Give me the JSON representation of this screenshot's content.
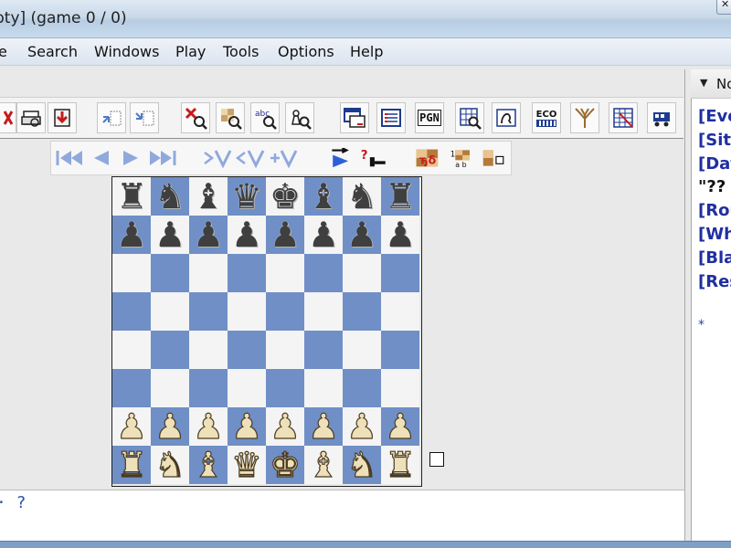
{
  "window": {
    "title": "pty] (game 0 / 0)"
  },
  "menu": {
    "items": [
      "e",
      "Search",
      "Windows",
      "Play",
      "Tools",
      "Options",
      "Help"
    ]
  },
  "toolbar": {
    "pgn_label": "PGN",
    "eco_label": "ECO"
  },
  "board": {
    "ranks": [
      [
        "r",
        "n",
        "b",
        "q",
        "k",
        "b",
        "n",
        "r"
      ],
      [
        "p",
        "p",
        "p",
        "p",
        "p",
        "p",
        "p",
        "p"
      ],
      [
        "",
        "",
        "",
        "",
        "",
        "",
        "",
        ""
      ],
      [
        "",
        "",
        "",
        "",
        "",
        "",
        "",
        ""
      ],
      [
        "",
        "",
        "",
        "",
        "",
        "",
        "",
        ""
      ],
      [
        "",
        "",
        "",
        "",
        "",
        "",
        "",
        ""
      ],
      [
        "P",
        "P",
        "P",
        "P",
        "P",
        "P",
        "P",
        "P"
      ],
      [
        "R",
        "N",
        "B",
        "Q",
        "K",
        "B",
        "N",
        "R"
      ]
    ],
    "colors": {
      "light": "#f4f4f4",
      "dark": "#6f8fc6"
    }
  },
  "status": {
    "text": "· ?"
  },
  "right_pane": {
    "header_label": "No",
    "pgn_lines": [
      "[Eve",
      "[Site",
      "[Dat",
      "\"??",
      "[Rou",
      "[Whi",
      "[Bla",
      "[Res"
    ],
    "result": "*"
  }
}
